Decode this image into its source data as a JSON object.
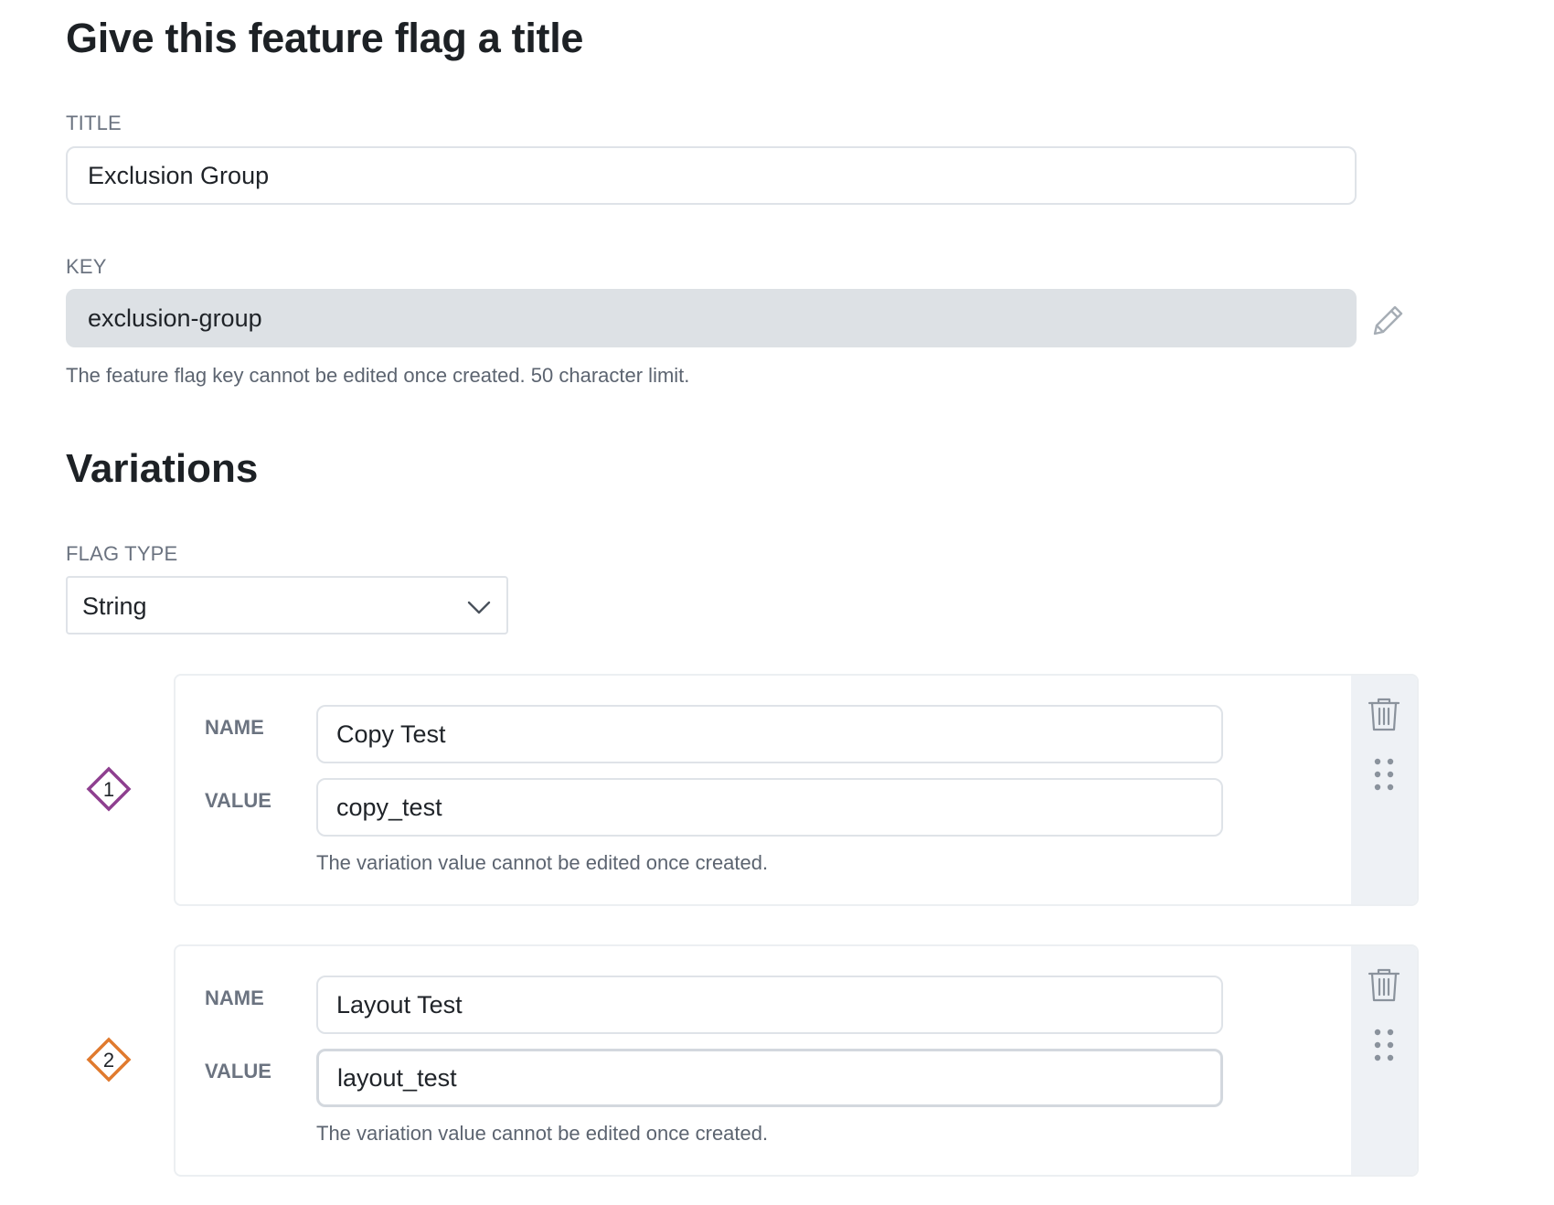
{
  "header": {
    "title": "Give this feature flag a title"
  },
  "title_field": {
    "label": "TITLE",
    "value": "Exclusion Group"
  },
  "key_field": {
    "label": "KEY",
    "value": "exclusion-group",
    "helper": "The feature flag key cannot be edited once created. 50 character limit.",
    "edit_icon": "pencil-icon"
  },
  "variations": {
    "title": "Variations",
    "flag_type": {
      "label": "FLAG TYPE",
      "selected": "String",
      "icon": "chevron-down-icon"
    },
    "items": [
      {
        "number": "1",
        "color": "#8e3f8f",
        "name_label": "NAME",
        "name_value": "Copy Test",
        "value_label": "VALUE",
        "value_value": "copy_test",
        "helper": "The variation value cannot be edited once created."
      },
      {
        "number": "2",
        "color": "#e07a2e",
        "name_label": "NAME",
        "name_value": "Layout Test",
        "value_label": "VALUE",
        "value_value": "layout_test",
        "helper": "The variation value cannot be edited once created."
      }
    ],
    "icons": {
      "delete": "trash-icon",
      "reorder": "drag-handle-icon"
    }
  }
}
